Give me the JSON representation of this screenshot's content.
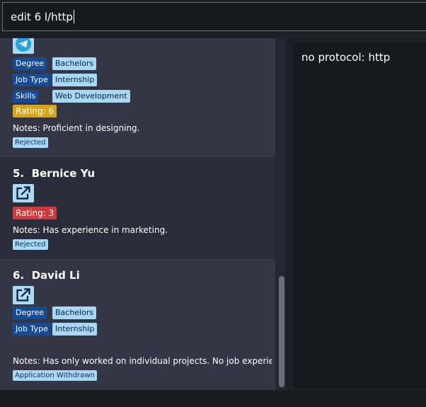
{
  "command": {
    "value": "edit 6 l/http"
  },
  "result": {
    "message": "no protocol: http"
  },
  "colors": {
    "tag_key_bg": "#174b93",
    "tag_val_bg": "#a9d8f6",
    "rating_medium": "#d8a418",
    "rating_low": "#d03a3a",
    "link_button_bg": "#aadaf8"
  },
  "cards": [
    {
      "name": "",
      "icons": [
        "telegram-icon"
      ],
      "tags": [
        {
          "key": "Degree",
          "value": "Bachelors"
        },
        {
          "key": "Job Type",
          "value": "Internship"
        },
        {
          "key": "Skills",
          "value": "Web Development"
        }
      ],
      "rating": "Rating: 6",
      "notes": "Notes: Proficient in designing.",
      "status": "Rejected"
    },
    {
      "name": "5.  Bernice Yu",
      "icons": [
        "external-link-icon"
      ],
      "tags": [],
      "rating": "Rating: 3",
      "notes": "Notes: Has experience in marketing.",
      "status": "Rejected"
    },
    {
      "name": "6.  David Li",
      "icons": [
        "external-link-icon"
      ],
      "tags": [
        {
          "key": "Degree",
          "value": "Bachelors"
        },
        {
          "key": "Job Type",
          "value": "Internship"
        }
      ],
      "rating": "",
      "notes": "Notes: Has only worked on individual projects. No job experie...",
      "status": "Application Withdrawn"
    }
  ]
}
